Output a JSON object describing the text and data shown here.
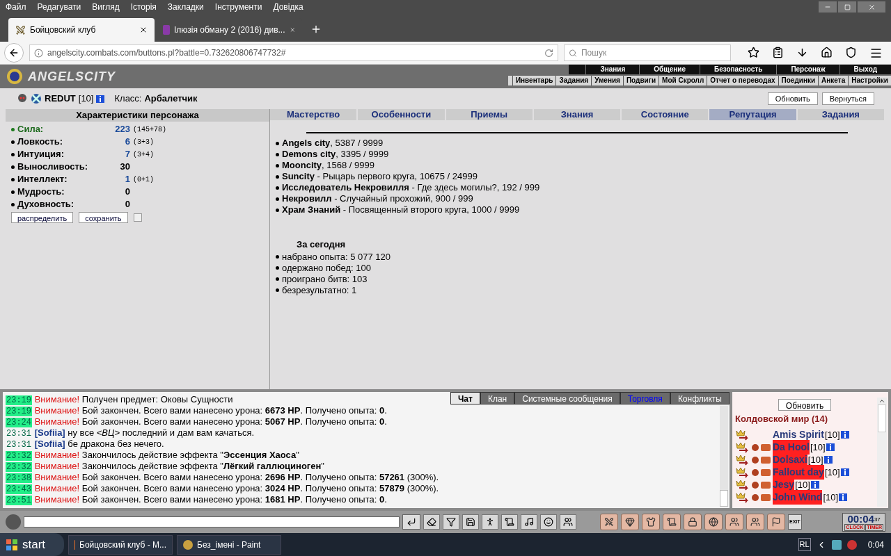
{
  "menu_bar": [
    "Файл",
    "Редагувати",
    "Вигляд",
    "Історія",
    "Закладки",
    "Інструменти",
    "Довідка"
  ],
  "tabs": [
    {
      "title": "Бойцовский клуб",
      "selected": true
    },
    {
      "title": "Ілюзія обману 2 (2016) див...",
      "selected": false
    }
  ],
  "address_bar": {
    "url": "angelscity.combats.com/buttons.pl?battle=0.732620806747732#"
  },
  "search": {
    "placeholder": "Пошук"
  },
  "game_header": {
    "logo": "ANGELSCITY",
    "nav_top": [
      "Знания",
      "Общение",
      "Безопасность",
      "Персонаж",
      "Выход"
    ],
    "nav_bottom": [
      "Инвентарь",
      "Задания",
      "Умения",
      "Подвиги",
      "Мой Скролл",
      "Отчет о переводах",
      "Поединки",
      "Анкета",
      "Настройки"
    ]
  },
  "character": {
    "name": "REDUT",
    "level": "[10]",
    "class_label": "Класс:",
    "class": "Арбалетчик"
  },
  "page_buttons": [
    "Обновить",
    "Вернуться"
  ],
  "stats": {
    "title": "Характеристики персонажа",
    "items": [
      {
        "name": "Сила:",
        "value": "223",
        "breakdown": "(145+78)",
        "selected": true
      },
      {
        "name": "Ловкость:",
        "value": "6",
        "breakdown": "(3+3)",
        "selected": false
      },
      {
        "name": "Интуиция:",
        "value": "7",
        "breakdown": "(3+4)",
        "selected": false
      },
      {
        "name": "Выносливость:",
        "value": "30",
        "selected": false
      },
      {
        "name": "Интеллект:",
        "value": "1",
        "breakdown": "(0+1)",
        "selected": false
      },
      {
        "name": "Мудрость:",
        "value": "0",
        "selected": false
      },
      {
        "name": "Духовность:",
        "value": "0",
        "selected": false
      }
    ],
    "buttons": [
      "распределить",
      "сохранить"
    ],
    "checkbox": {
      "checked": false
    }
  },
  "section_tabs": [
    {
      "label": "Мастерство",
      "selected": false
    },
    {
      "label": "Особенности",
      "selected": false
    },
    {
      "label": "Приемы",
      "selected": false
    },
    {
      "label": "Знания",
      "selected": false
    },
    {
      "label": "Состояние",
      "selected": false
    },
    {
      "label": "Репутация",
      "selected": true
    },
    {
      "label": "Задания",
      "selected": false
    }
  ],
  "reputation": [
    "**Angels city**, 5387 / 9999",
    "**Demons city**, 3395 / 9999",
    "**Mooncity**, 1568 / 9999",
    "**Suncity** - Рыцарь первого круга, 10675 / 24999",
    "**Исследователь Некровилля** - Где здесь могилы?, 192 / 999",
    "**Некровилл** - Случайный прохожий, 900 / 999",
    "**Храм Знаний** - Посвященный второго круга, 1000 / 9999"
  ],
  "today": {
    "title": "За сегодня",
    "items": [
      "набрано опыта: 5 077 120",
      "одержано побед: 100",
      "проиграно битв: 103",
      "безрезультатно: 1"
    ]
  },
  "chat_tabs": [
    {
      "label": "Чат",
      "selected": true,
      "kind": "tab"
    },
    {
      "label": "Клан",
      "selected": false,
      "kind": "tab"
    },
    {
      "label": "Системные сообщения",
      "selected": false,
      "kind": "tab"
    },
    {
      "label": "Торговля",
      "selected": false,
      "kind": "link"
    },
    {
      "label": "Конфликты",
      "selected": false,
      "kind": "tab"
    }
  ],
  "chat": [
    {
      "kind": "system",
      "time": "23:19",
      "sender": "Внимание!",
      "text": "Получен предмет: Оковы Сущности"
    },
    {
      "kind": "system",
      "time": "23:19",
      "sender": "Внимание!",
      "text": "Бой закончен. Всего вами нанесено урона: **6673 HP**. Получено опыта: **0**."
    },
    {
      "kind": "system",
      "time": "23:24",
      "sender": "Внимание!",
      "text": "Бой закончен. Всего вами нанесено урона: **5067 HP**. Получено опыта: **0**."
    },
    {
      "kind": "user",
      "time": "23:31",
      "sender": "[Sofiia]",
      "text": "ну все *<ВЦ>* последний и дам вам качаться."
    },
    {
      "kind": "user",
      "time": "23:31",
      "sender": "[Sofiia]",
      "text": "бе дракона без нечего."
    },
    {
      "kind": "system",
      "time": "23:32",
      "sender": "Внимание!",
      "text": "Закончилось действие эффекта \"**Эссенция Хаоса**\""
    },
    {
      "kind": "system",
      "time": "23:32",
      "sender": "Внимание!",
      "text": "Закончилось действие эффекта \"**Лёгкий галлюциноген**\""
    },
    {
      "kind": "system",
      "time": "23:38",
      "sender": "Внимание!",
      "text": "Бой закончен. Всего вами нанесено урона: **2696 HP**. Получено опыта: **57261** (300%)."
    },
    {
      "kind": "system",
      "time": "23:43",
      "sender": "Внимание!",
      "text": "Бой закончен. Всего вами нанесено урона: **3024 HP**. Получено опыта: **57879** (300%)."
    },
    {
      "kind": "system",
      "time": "23:51",
      "sender": "Внимание!",
      "text": "Бой закончен. Всего вами нанесено урона: **1681 HP**. Получено опыта: **0**."
    }
  ],
  "online": {
    "button": "Обновить",
    "title": "Колдовской мир (14)",
    "players": [
      {
        "name": "Amis Spirit",
        "level": "[10]",
        "highlighted": false
      },
      {
        "name": "Da Hool",
        "level": "[10]",
        "highlighted": true
      },
      {
        "name": "Dolsaxi",
        "level": "[10]",
        "highlighted": true
      },
      {
        "name": "Fallout day",
        "level": "[10]",
        "highlighted": true
      },
      {
        "name": "Jesy",
        "level": "[10]",
        "highlighted": true
      },
      {
        "name": "John Wind",
        "level": "[10]",
        "highlighted": true
      }
    ]
  },
  "clock": {
    "time": "00:04",
    "seconds": "37",
    "labels": [
      "CLOCK",
      "TIMER"
    ],
    "exit": "EXIT"
  },
  "taskbar": {
    "start": "start",
    "items": [
      "Бойцовский клуб - M...",
      "Без_імені - Paint"
    ],
    "language": "RL",
    "time": "0:04"
  }
}
